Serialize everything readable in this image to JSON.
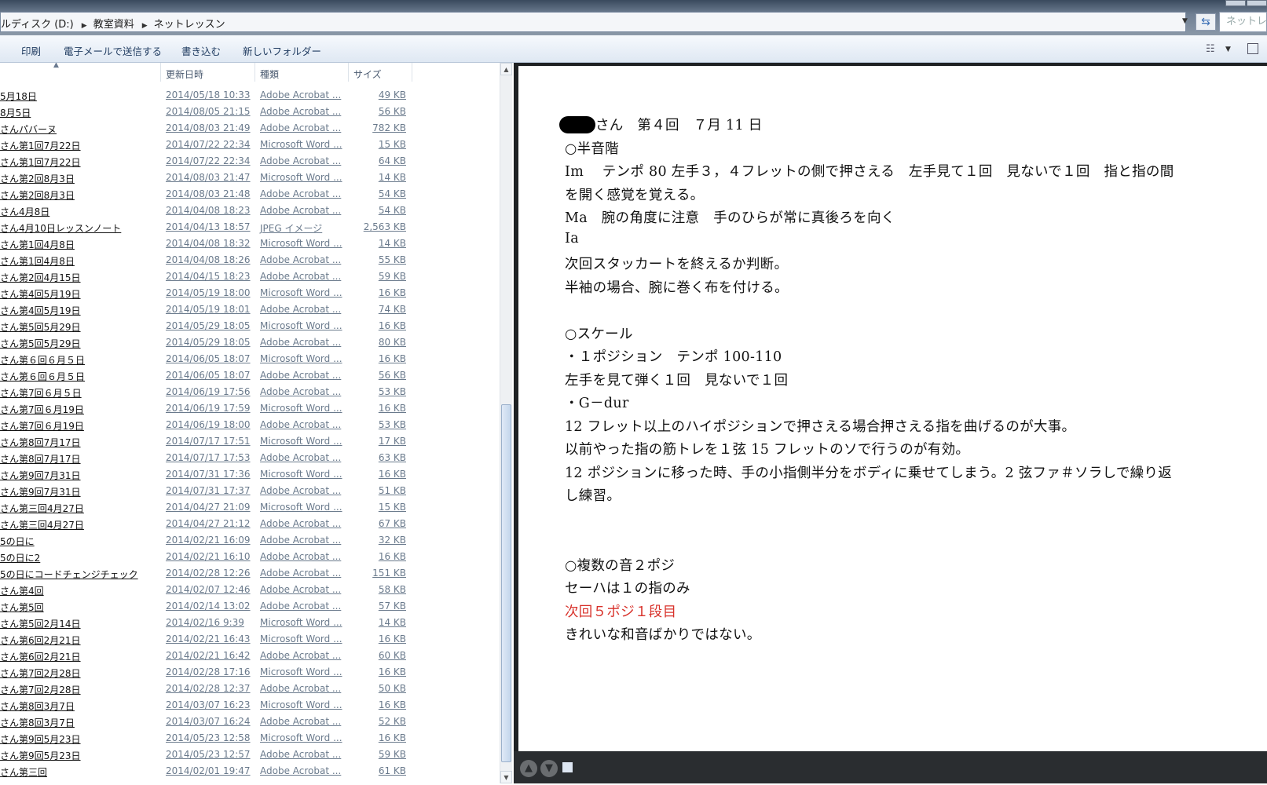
{
  "address_bar": {
    "crumbs": [
      "ルディスク (D:)",
      "教室資料",
      "ネットレッスン"
    ],
    "search_placeholder": "ネットレ"
  },
  "toolbar": {
    "print": "印刷",
    "email": "電子メールで送信する",
    "burn": "書き込む",
    "new_folder": "新しいフォルダー"
  },
  "columns": {
    "date": "更新日時",
    "type": "種類",
    "size": "サイズ"
  },
  "files": [
    {
      "name": "5月18日",
      "date": "2014/05/18 10:33",
      "type": "Adobe Acrobat ...",
      "size": "49 KB"
    },
    {
      "name": "8月5日",
      "date": "2014/08/05 21:15",
      "type": "Adobe Acrobat ...",
      "size": "56 KB"
    },
    {
      "name": "さんパバーヌ",
      "date": "2014/08/03 21:49",
      "type": "Adobe Acrobat ...",
      "size": "782 KB"
    },
    {
      "name": "さん第1回7月22日",
      "date": "2014/07/22 22:34",
      "type": "Microsoft Word ...",
      "size": "15 KB"
    },
    {
      "name": "さん第1回7月22日",
      "date": "2014/07/22 22:34",
      "type": "Adobe Acrobat ...",
      "size": "64 KB"
    },
    {
      "name": "さん第2回8月3日",
      "date": "2014/08/03 21:47",
      "type": "Microsoft Word ...",
      "size": "14 KB"
    },
    {
      "name": "さん第2回8月3日",
      "date": "2014/08/03 21:48",
      "type": "Adobe Acrobat ...",
      "size": "54 KB"
    },
    {
      "name": "さん4月8日",
      "date": "2014/04/08 18:23",
      "type": "Adobe Acrobat ...",
      "size": "54 KB"
    },
    {
      "name": "さん4月10日レッスンノート",
      "date": "2014/04/13 18:57",
      "type": "JPEG イメージ",
      "size": "2,563 KB"
    },
    {
      "name": "さん第1回4月8日",
      "date": "2014/04/08 18:32",
      "type": "Microsoft Word ...",
      "size": "14 KB"
    },
    {
      "name": "さん第1回4月8日",
      "date": "2014/04/08 18:26",
      "type": "Adobe Acrobat ...",
      "size": "55 KB"
    },
    {
      "name": "さん第2回4月15日",
      "date": "2014/04/15 18:23",
      "type": "Adobe Acrobat ...",
      "size": "59 KB"
    },
    {
      "name": "さん第4回5月19日",
      "date": "2014/05/19 18:00",
      "type": "Microsoft Word ...",
      "size": "16 KB"
    },
    {
      "name": "さん第4回5月19日",
      "date": "2014/05/19 18:01",
      "type": "Adobe Acrobat ...",
      "size": "74 KB"
    },
    {
      "name": "さん第5回5月29日",
      "date": "2014/05/29 18:05",
      "type": "Microsoft Word ...",
      "size": "16 KB"
    },
    {
      "name": "さん第5回5月29日",
      "date": "2014/05/29 18:05",
      "type": "Adobe Acrobat ...",
      "size": "80 KB"
    },
    {
      "name": "さん第６回６月５日",
      "date": "2014/06/05 18:07",
      "type": "Microsoft Word ...",
      "size": "16 KB"
    },
    {
      "name": "さん第６回６月５日",
      "date": "2014/06/05 18:07",
      "type": "Adobe Acrobat ...",
      "size": "56 KB"
    },
    {
      "name": "さん第7回６月５日",
      "date": "2014/06/19 17:56",
      "type": "Adobe Acrobat ...",
      "size": "53 KB"
    },
    {
      "name": "さん第7回６月19日",
      "date": "2014/06/19 17:59",
      "type": "Microsoft Word ...",
      "size": "16 KB"
    },
    {
      "name": "さん第7回６月19日",
      "date": "2014/06/19 18:00",
      "type": "Adobe Acrobat ...",
      "size": "53 KB"
    },
    {
      "name": "さん第8回7月17日",
      "date": "2014/07/17 17:51",
      "type": "Microsoft Word ...",
      "size": "17 KB"
    },
    {
      "name": "さん第8回7月17日",
      "date": "2014/07/17 17:53",
      "type": "Adobe Acrobat ...",
      "size": "63 KB"
    },
    {
      "name": "さん第9回7月31日",
      "date": "2014/07/31 17:36",
      "type": "Microsoft Word ...",
      "size": "16 KB"
    },
    {
      "name": "さん第9回7月31日",
      "date": "2014/07/31 17:37",
      "type": "Adobe Acrobat ...",
      "size": "51 KB"
    },
    {
      "name": "さん第三回4月27日",
      "date": "2014/04/27 21:09",
      "type": "Microsoft Word ...",
      "size": "15 KB"
    },
    {
      "name": "さん第三回4月27日",
      "date": "2014/04/27 21:12",
      "type": "Adobe Acrobat ...",
      "size": "67 KB"
    },
    {
      "name": "5の日に",
      "date": "2014/02/21 16:09",
      "type": "Adobe Acrobat ...",
      "size": "32 KB"
    },
    {
      "name": "5の日に2",
      "date": "2014/02/21 16:10",
      "type": "Adobe Acrobat ...",
      "size": "16 KB"
    },
    {
      "name": "5の日にコードチェンジチェック",
      "date": "2014/02/28 12:26",
      "type": "Adobe Acrobat ...",
      "size": "151 KB"
    },
    {
      "name": "さん第4回",
      "date": "2014/02/07 12:46",
      "type": "Adobe Acrobat ...",
      "size": "58 KB"
    },
    {
      "name": "さん第5回",
      "date": "2014/02/14 13:02",
      "type": "Adobe Acrobat ...",
      "size": "57 KB"
    },
    {
      "name": "さん第5回2月14日",
      "date": "2014/02/16 9:39",
      "type": "Microsoft Word ...",
      "size": "14 KB"
    },
    {
      "name": "さん第6回2月21日",
      "date": "2014/02/21 16:43",
      "type": "Microsoft Word ...",
      "size": "16 KB"
    },
    {
      "name": "さん第6回2月21日",
      "date": "2014/02/21 16:42",
      "type": "Adobe Acrobat ...",
      "size": "60 KB"
    },
    {
      "name": "さん第7回2月28日",
      "date": "2014/02/28 17:16",
      "type": "Microsoft Word ...",
      "size": "16 KB"
    },
    {
      "name": "さん第7回2月28日",
      "date": "2014/02/28 12:37",
      "type": "Adobe Acrobat ...",
      "size": "50 KB"
    },
    {
      "name": "さん第8回3月7日",
      "date": "2014/03/07 16:23",
      "type": "Microsoft Word ...",
      "size": "16 KB"
    },
    {
      "name": "さん第8回3月7日",
      "date": "2014/03/07 16:24",
      "type": "Adobe Acrobat ...",
      "size": "52 KB"
    },
    {
      "name": "さん第9回5月23日",
      "date": "2014/05/23 12:58",
      "type": "Microsoft Word ...",
      "size": "16 KB"
    },
    {
      "name": "さん第9回5月23日",
      "date": "2014/05/23 12:57",
      "type": "Adobe Acrobat ...",
      "size": "59 KB"
    },
    {
      "name": "さん第三回",
      "date": "2014/02/01 19:47",
      "type": "Adobe Acrobat ...",
      "size": "61 KB"
    }
  ],
  "preview": {
    "lines": [
      {
        "text": "さん　第４回　７月 11 日",
        "red": false
      },
      {
        "text": "○半音階",
        "red": false
      },
      {
        "text": "Im　 テンポ 80 左手３，４フレットの側で押さえる　左手見て１回　見ないで１回　指と指の間",
        "red": false
      },
      {
        "text": "を開く感覚を覚える。",
        "red": false
      },
      {
        "text": "Ma　腕の角度に注意　手のひらが常に真後ろを向く",
        "red": false
      },
      {
        "text": "Ia",
        "red": false
      },
      {
        "text": "次回スタッカートを終えるか判断。",
        "red": false
      },
      {
        "text": "半袖の場合、腕に巻く布を付ける。",
        "red": false
      },
      {
        "text": "",
        "red": false
      },
      {
        "text": "○スケール",
        "red": false
      },
      {
        "text": "・１ポジション　テンポ 100-110",
        "red": false
      },
      {
        "text": "左手を見て弾く１回　見ないで１回",
        "red": false
      },
      {
        "text": "・G－dur",
        "red": false
      },
      {
        "text": "12 フレット以上のハイポジションで押さえる場合押さえる指を曲げるのが大事。",
        "red": false
      },
      {
        "text": "以前やった指の筋トレを１弦 15 フレットのソで行うのが有効。",
        "red": false
      },
      {
        "text": "12 ポジションに移った時、手の小指側半分をボディに乗せてしまう。2 弦ファ＃ソラしで繰り返",
        "red": false
      },
      {
        "text": "し練習。",
        "red": false
      },
      {
        "text": "",
        "red": false
      },
      {
        "text": "",
        "red": false
      },
      {
        "text": "○複数の音２ポジ",
        "red": false
      },
      {
        "text": "セーハは１の指のみ",
        "red": false
      },
      {
        "text": "次回５ポジ１段目",
        "red": true
      },
      {
        "text": "きれいな和音ばかりではない。",
        "red": false
      }
    ]
  }
}
